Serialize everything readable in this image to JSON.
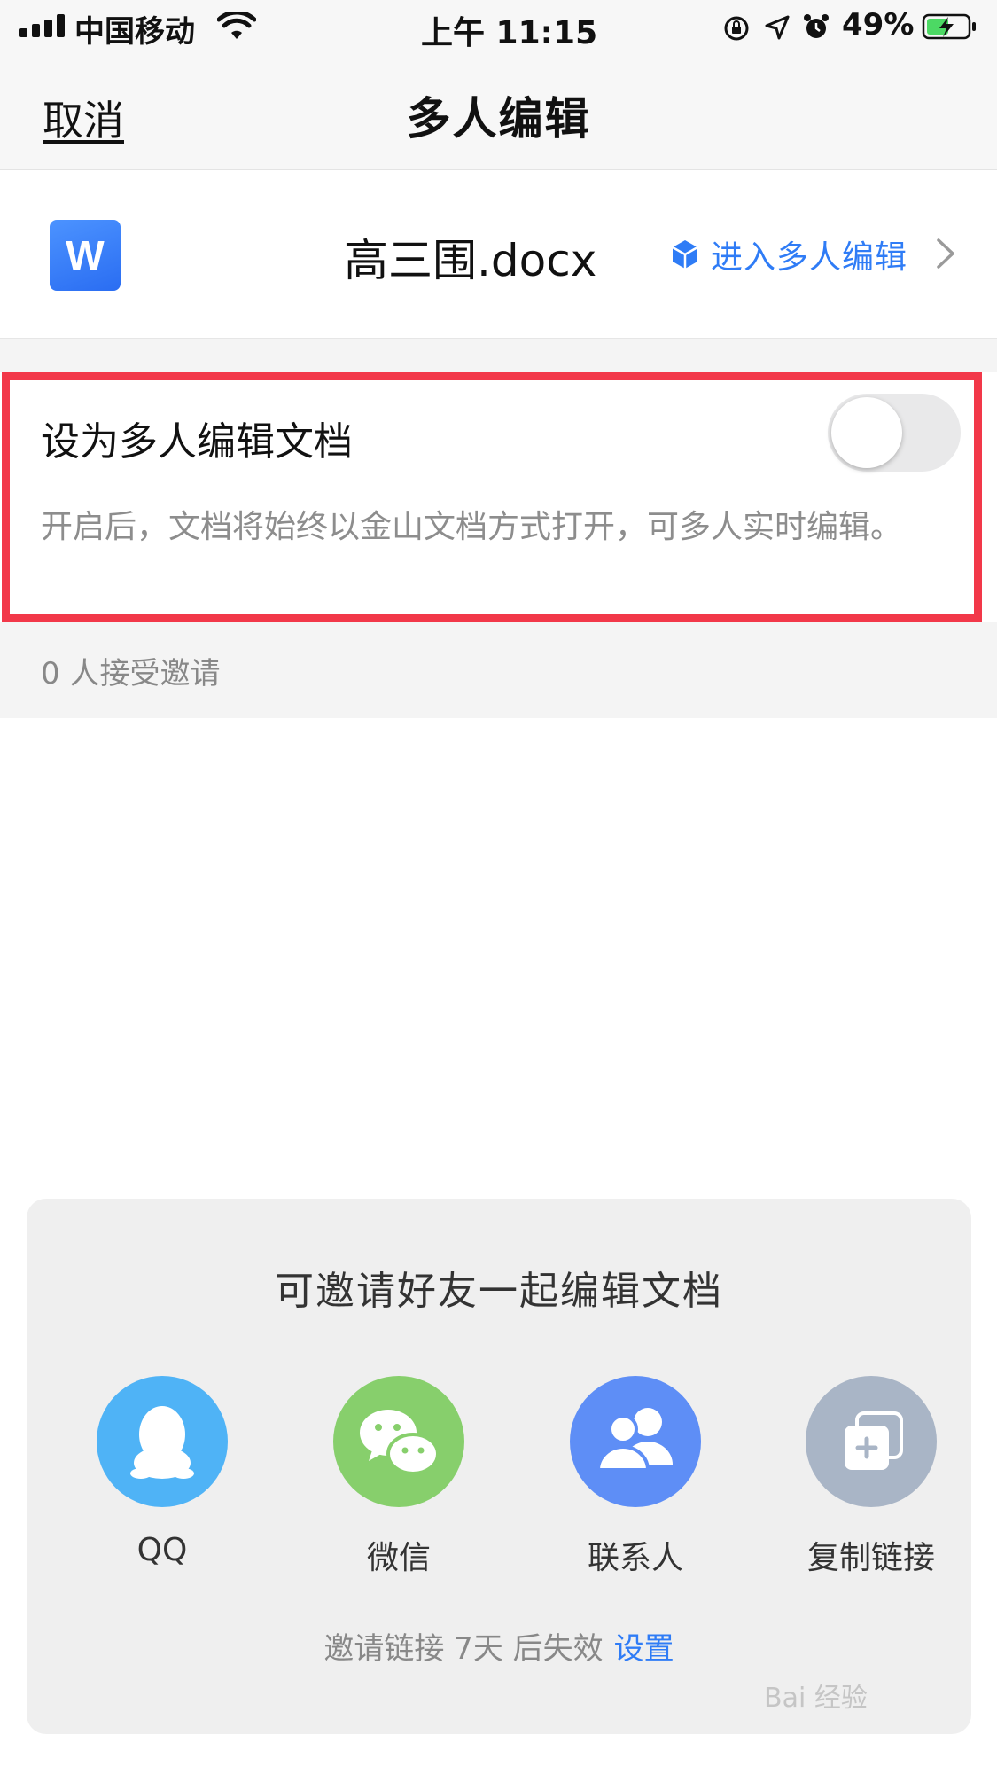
{
  "status_bar": {
    "carrier": "中国移动",
    "time": "上午 11:15",
    "battery_percent": "49%",
    "icons": [
      "signal-icon",
      "wifi-icon",
      "orientation-lock-icon",
      "location-icon",
      "alarm-icon",
      "battery-charging-icon"
    ]
  },
  "nav": {
    "cancel_label": "取消",
    "title": "多人编辑"
  },
  "file": {
    "name": "高三围.docx",
    "icon_letter": "W",
    "enter_label": "进入多人编辑",
    "colors": {
      "icon": "#2a6df2",
      "link": "#2f7cf6"
    }
  },
  "setting": {
    "title": "设为多人编辑文档",
    "description": "开启后，文档将始终以金山文档方式打开，可多人实时编辑。",
    "toggle_on": false,
    "highlight_color": "#f23849"
  },
  "invite_count": "0 人接受邀请",
  "share": {
    "title": "可邀请好友一起编辑文档",
    "items": [
      {
        "label": "QQ",
        "icon": "qq-icon",
        "color": "#4fb3f6"
      },
      {
        "label": "微信",
        "icon": "wechat-icon",
        "color": "#87cf6c"
      },
      {
        "label": "联系人",
        "icon": "contacts-icon",
        "color": "#5e8ef6"
      },
      {
        "label": "复制链接",
        "icon": "copy-link-icon",
        "color": "#a9b5c6"
      }
    ],
    "expire_text": "邀请链接 7天 后失效",
    "expire_set_label": "设置"
  },
  "watermark": "Bai 经验"
}
